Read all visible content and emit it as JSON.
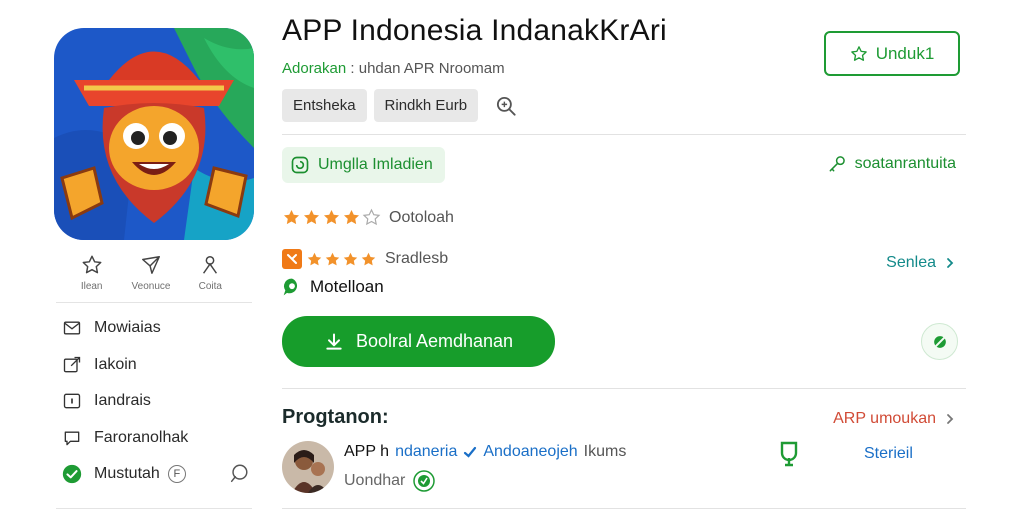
{
  "app": {
    "title": "APP Indonesia IndanakKrAri",
    "developer_name": "Adorakan",
    "developer_sub": ": uhdan APR Nroomam",
    "icon_name": "app-mascot-icon"
  },
  "quick_actions": [
    {
      "label": "Ilean",
      "icon": "star-outline-icon"
    },
    {
      "label": "Veonuce",
      "icon": "share-icon"
    },
    {
      "label": "Coita",
      "icon": "person-icon"
    }
  ],
  "sidebar": {
    "items": [
      {
        "label": "Mowiaias",
        "icon": "mail-icon"
      },
      {
        "label": "Iakoin",
        "icon": "external-link-icon"
      },
      {
        "label": "Iandrais",
        "icon": "info-box-icon"
      },
      {
        "label": "Faroranolhak",
        "icon": "chat-bubble-icon"
      },
      {
        "label": "Mustutah",
        "icon": "check-circle-icon",
        "badge": "F"
      }
    ]
  },
  "install_top": {
    "label": "Unduk1"
  },
  "tags": [
    "Entsheka",
    "Rindkh Eurb"
  ],
  "update_chip": {
    "label": "Umglla Imladien"
  },
  "key_link": {
    "label": "soatanrantuita"
  },
  "rating": {
    "value": 4,
    "max": 5,
    "text": "Ootoloah"
  },
  "rating2": {
    "value": 4,
    "max": 4,
    "text": "Sradlesb"
  },
  "see_all": {
    "label": "Senlea"
  },
  "review": {
    "label": "Motelloan"
  },
  "install_main": {
    "label": "Boolral Aemdhanan"
  },
  "section": {
    "title": "Progtanon:",
    "link": "ARP umoukan"
  },
  "entry": {
    "name": "APP h",
    "highlight": "ndaneria",
    "sub": "Andoaneojeh",
    "tail": "Ikums",
    "line2": "Uondhar",
    "action": "Sterieil"
  },
  "colors": {
    "primary_green": "#179d2b",
    "link_teal": "#138a8a",
    "link_red": "#d14b36",
    "link_blue": "#1a6fc7",
    "star_orange": "#f2922b"
  }
}
